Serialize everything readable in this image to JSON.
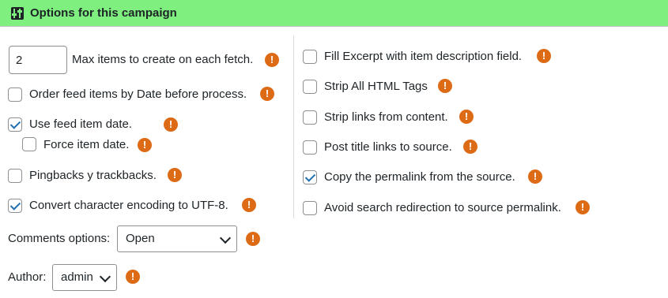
{
  "header": {
    "title": "Options for this campaign",
    "icon": "sliders-icon"
  },
  "left": {
    "max_items": {
      "value": "2",
      "label": "Max items to create on each fetch."
    },
    "order_date": {
      "label": "Order feed items by Date before process.",
      "checked": false
    },
    "use_feed_date": {
      "label": "Use feed item date.",
      "checked": true
    },
    "force_date": {
      "label": "Force item date.",
      "checked": false
    },
    "pingbacks": {
      "label": "Pingbacks y trackbacks.",
      "checked": false
    },
    "utf8": {
      "label": "Convert character encoding to UTF-8.",
      "checked": true
    },
    "comments": {
      "label": "Comments options:",
      "value": "Open"
    },
    "author": {
      "label": "Author:",
      "value": "admin"
    }
  },
  "right": {
    "fill_excerpt": {
      "label": "Fill Excerpt with item description field.",
      "checked": false
    },
    "strip_html": {
      "label": "Strip All HTML Tags",
      "checked": false
    },
    "strip_links": {
      "label": "Strip links from content.",
      "checked": false
    },
    "title_links": {
      "label": "Post title links to source.",
      "checked": false
    },
    "copy_permalink": {
      "label": "Copy the permalink from the source.",
      "checked": true
    },
    "avoid_redirect": {
      "label": "Avoid search redirection to source permalink.",
      "checked": false
    }
  },
  "info_glyph": "!",
  "colors": {
    "header_bg": "#7ff07f",
    "info": "#dd6b16",
    "check": "#2271b1"
  }
}
